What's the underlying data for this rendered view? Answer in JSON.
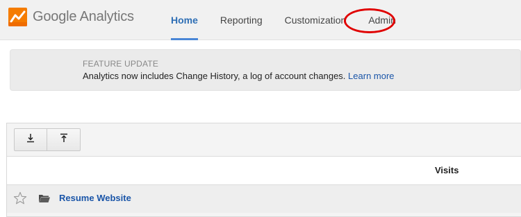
{
  "app": {
    "brand": "Google Analytics",
    "brand_google": "Google",
    "brand_product": "Analytics"
  },
  "nav": {
    "tabs": [
      {
        "label": "Home",
        "active": true
      },
      {
        "label": "Reporting",
        "active": false
      },
      {
        "label": "Customization",
        "active": false
      },
      {
        "label": "Admin",
        "active": false
      }
    ]
  },
  "banner": {
    "kicker": "FEATURE UPDATE",
    "message": "Analytics now includes Change History, a log of account changes.",
    "link": "Learn more"
  },
  "toolbar": {
    "buttons": [
      {
        "icon": "download-icon"
      },
      {
        "icon": "upload-icon"
      }
    ]
  },
  "table": {
    "columns": [
      "Visits"
    ],
    "rows": [
      {
        "name": "Resume Website",
        "starred": false,
        "icon": "folder-icon"
      }
    ]
  },
  "colors": {
    "accent": "#4a86d6",
    "link": "#1a55a8",
    "annotation": "#e00000",
    "logo_orange": "#f57c00",
    "logo_yellow": "#ffb300"
  }
}
